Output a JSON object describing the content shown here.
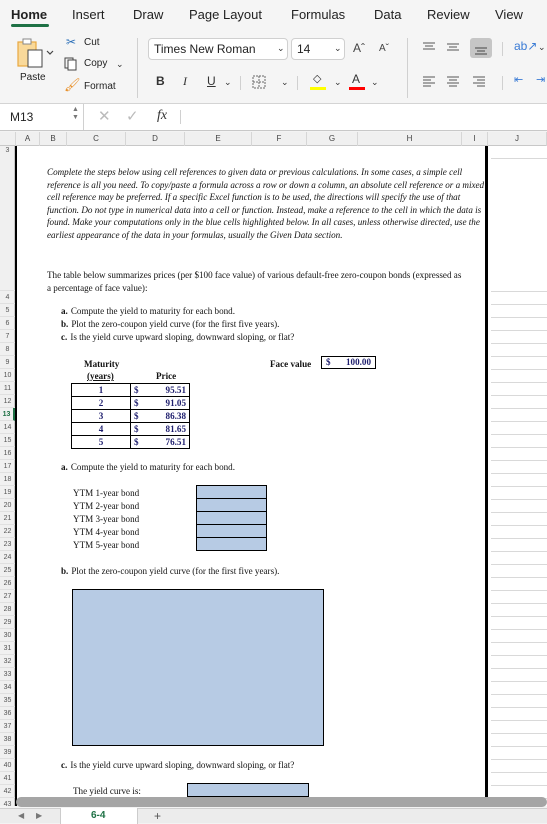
{
  "ribbon_tabs": [
    {
      "label": "Home",
      "active": true
    },
    {
      "label": "Insert"
    },
    {
      "label": "Draw"
    },
    {
      "label": "Page Layout"
    },
    {
      "label": "Formulas"
    },
    {
      "label": "Data"
    },
    {
      "label": "Review"
    },
    {
      "label": "View"
    }
  ],
  "clipboard": {
    "paste_label": "Paste",
    "cut_label": "Cut",
    "copy_label": "Copy",
    "format_label": "Format"
  },
  "font": {
    "name": "Times New Roman",
    "size": "14",
    "bold": "B",
    "italic": "I",
    "underline": "U",
    "grow": "Aˆ",
    "shrink": "Aˇ",
    "fill_color": "#ffff00",
    "font_color": "#ff0000"
  },
  "formula_bar": {
    "name_box": "M13",
    "fx": "fx",
    "value": ""
  },
  "columns": [
    "A",
    "B",
    "C",
    "D",
    "E",
    "F",
    "G",
    "H",
    "I",
    "J"
  ],
  "rows": [
    "3",
    "4",
    "5",
    "6",
    "7",
    "8",
    "9",
    "10",
    "11",
    "12",
    "13",
    "14",
    "15",
    "16",
    "17",
    "18",
    "19",
    "20",
    "21",
    "22",
    "23",
    "24",
    "25",
    "26",
    "27",
    "28",
    "29",
    "30",
    "31",
    "32",
    "33",
    "34",
    "35",
    "36",
    "37",
    "38",
    "39",
    "40",
    "41",
    "42",
    "43"
  ],
  "selected_row": "13",
  "sheet": {
    "intro": "Complete the steps below using cell references to given data or previous calculations. In some cases, a simple cell reference is all you need. To copy/paste a formula across a row or down a column, an absolute cell reference or a mixed cell reference may be preferred. If a specific Excel function is to be used, the directions will specify the use of that function. Do not type in numerical data into a cell or function. Instead, make a reference to the cell in which the data is found. Make your computations only in the blue cells highlighted below. In all cases, unless otherwise directed, use the earliest appearance of the data in your formulas, usually the Given Data section.",
    "table_intro": "The table below summarizes prices (per $100 face value) of various default-free zero-coupon bonds (expressed as a percentage of face value):",
    "steps": [
      {
        "letter": "a.",
        "text": "Compute the yield to maturity for each bond."
      },
      {
        "letter": "b.",
        "text": "Plot the zero-coupon yield curve (for the first five years)."
      },
      {
        "letter": "c.",
        "text": "Is the yield curve upward sloping, downward sloping, or flat?"
      }
    ],
    "maturity_header_1": "Maturity",
    "maturity_header_2": "(years)",
    "price_header": "Price",
    "face_value_label": "Face value",
    "face_value_currency": "$",
    "face_value": "100.00",
    "bonds": [
      {
        "maturity": "1",
        "currency": "$",
        "price": "95.51"
      },
      {
        "maturity": "2",
        "currency": "$",
        "price": "91.05"
      },
      {
        "maturity": "3",
        "currency": "$",
        "price": "86.38"
      },
      {
        "maturity": "4",
        "currency": "$",
        "price": "81.65"
      },
      {
        "maturity": "5",
        "currency": "$",
        "price": "76.51"
      }
    ],
    "ytm_labels": [
      "YTM 1-year bond",
      "YTM 2-year bond",
      "YTM 3-year bond",
      "YTM 4-year bond",
      "YTM 5-year bond"
    ],
    "yield_curve_label": "The yield curve is:",
    "input_cell_color": "#b7cbe4"
  },
  "sheet_tabs": [
    {
      "label": "6-4",
      "active": true
    }
  ],
  "add_sheet": "+"
}
